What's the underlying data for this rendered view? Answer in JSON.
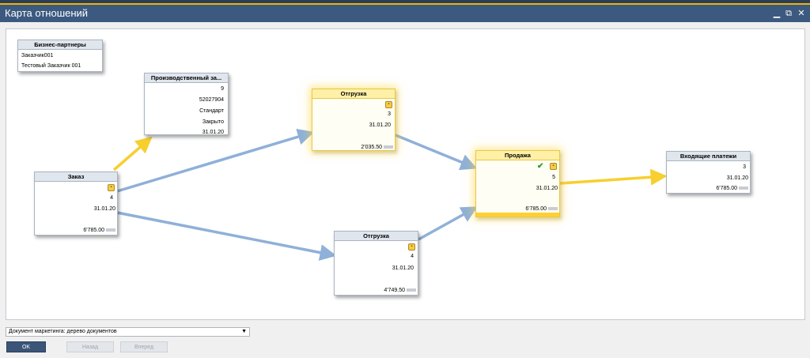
{
  "window": {
    "title": "Карта отношений",
    "controls": {
      "minimize": "▁",
      "restore": "⧉",
      "close": "✕"
    }
  },
  "bp_box": {
    "title": "Бизнес-партнеры",
    "items": [
      "Заказчик001",
      "Тестовый Заказчик 001"
    ]
  },
  "nodes": {
    "order": {
      "title": "Заказ",
      "icon": "lock-icon",
      "number": "4",
      "date": "31.01.20",
      "amount": "6'785.00"
    },
    "prod_order": {
      "title": "Производственный за...",
      "number": "9",
      "item": "52027904",
      "type": "Стандарт",
      "status": "Закрыто",
      "date": "31.01.20"
    },
    "delivery_top": {
      "title": "Отгрузка",
      "icon": "lock-icon",
      "number": "3",
      "date": "31.01.20",
      "amount": "2'035.50"
    },
    "delivery_bottom": {
      "title": "Отгрузка",
      "icon": "lock-icon",
      "number": "4",
      "date": "31.01.20",
      "amount": "4'749.50"
    },
    "sale": {
      "title": "Продажа",
      "icons": [
        "check-edit-icon",
        "lock-icon"
      ],
      "number": "5",
      "date": "31.01.20",
      "amount": "6'785.00"
    },
    "incoming_payments": {
      "title": "Входящие платежи",
      "number": "3",
      "date": "31.01.20",
      "amount": "6'785.00"
    }
  },
  "colors": {
    "link_blue": "#8fb0d8",
    "link_yellow": "#f7cf2e",
    "highlight": "#fff0a8",
    "title_bar": "#3c5a80"
  },
  "footer": {
    "dropdown_value": "Документ маркетинга: дерево документов",
    "ok": "OK",
    "back": "Назад",
    "forward": "Вперед"
  }
}
